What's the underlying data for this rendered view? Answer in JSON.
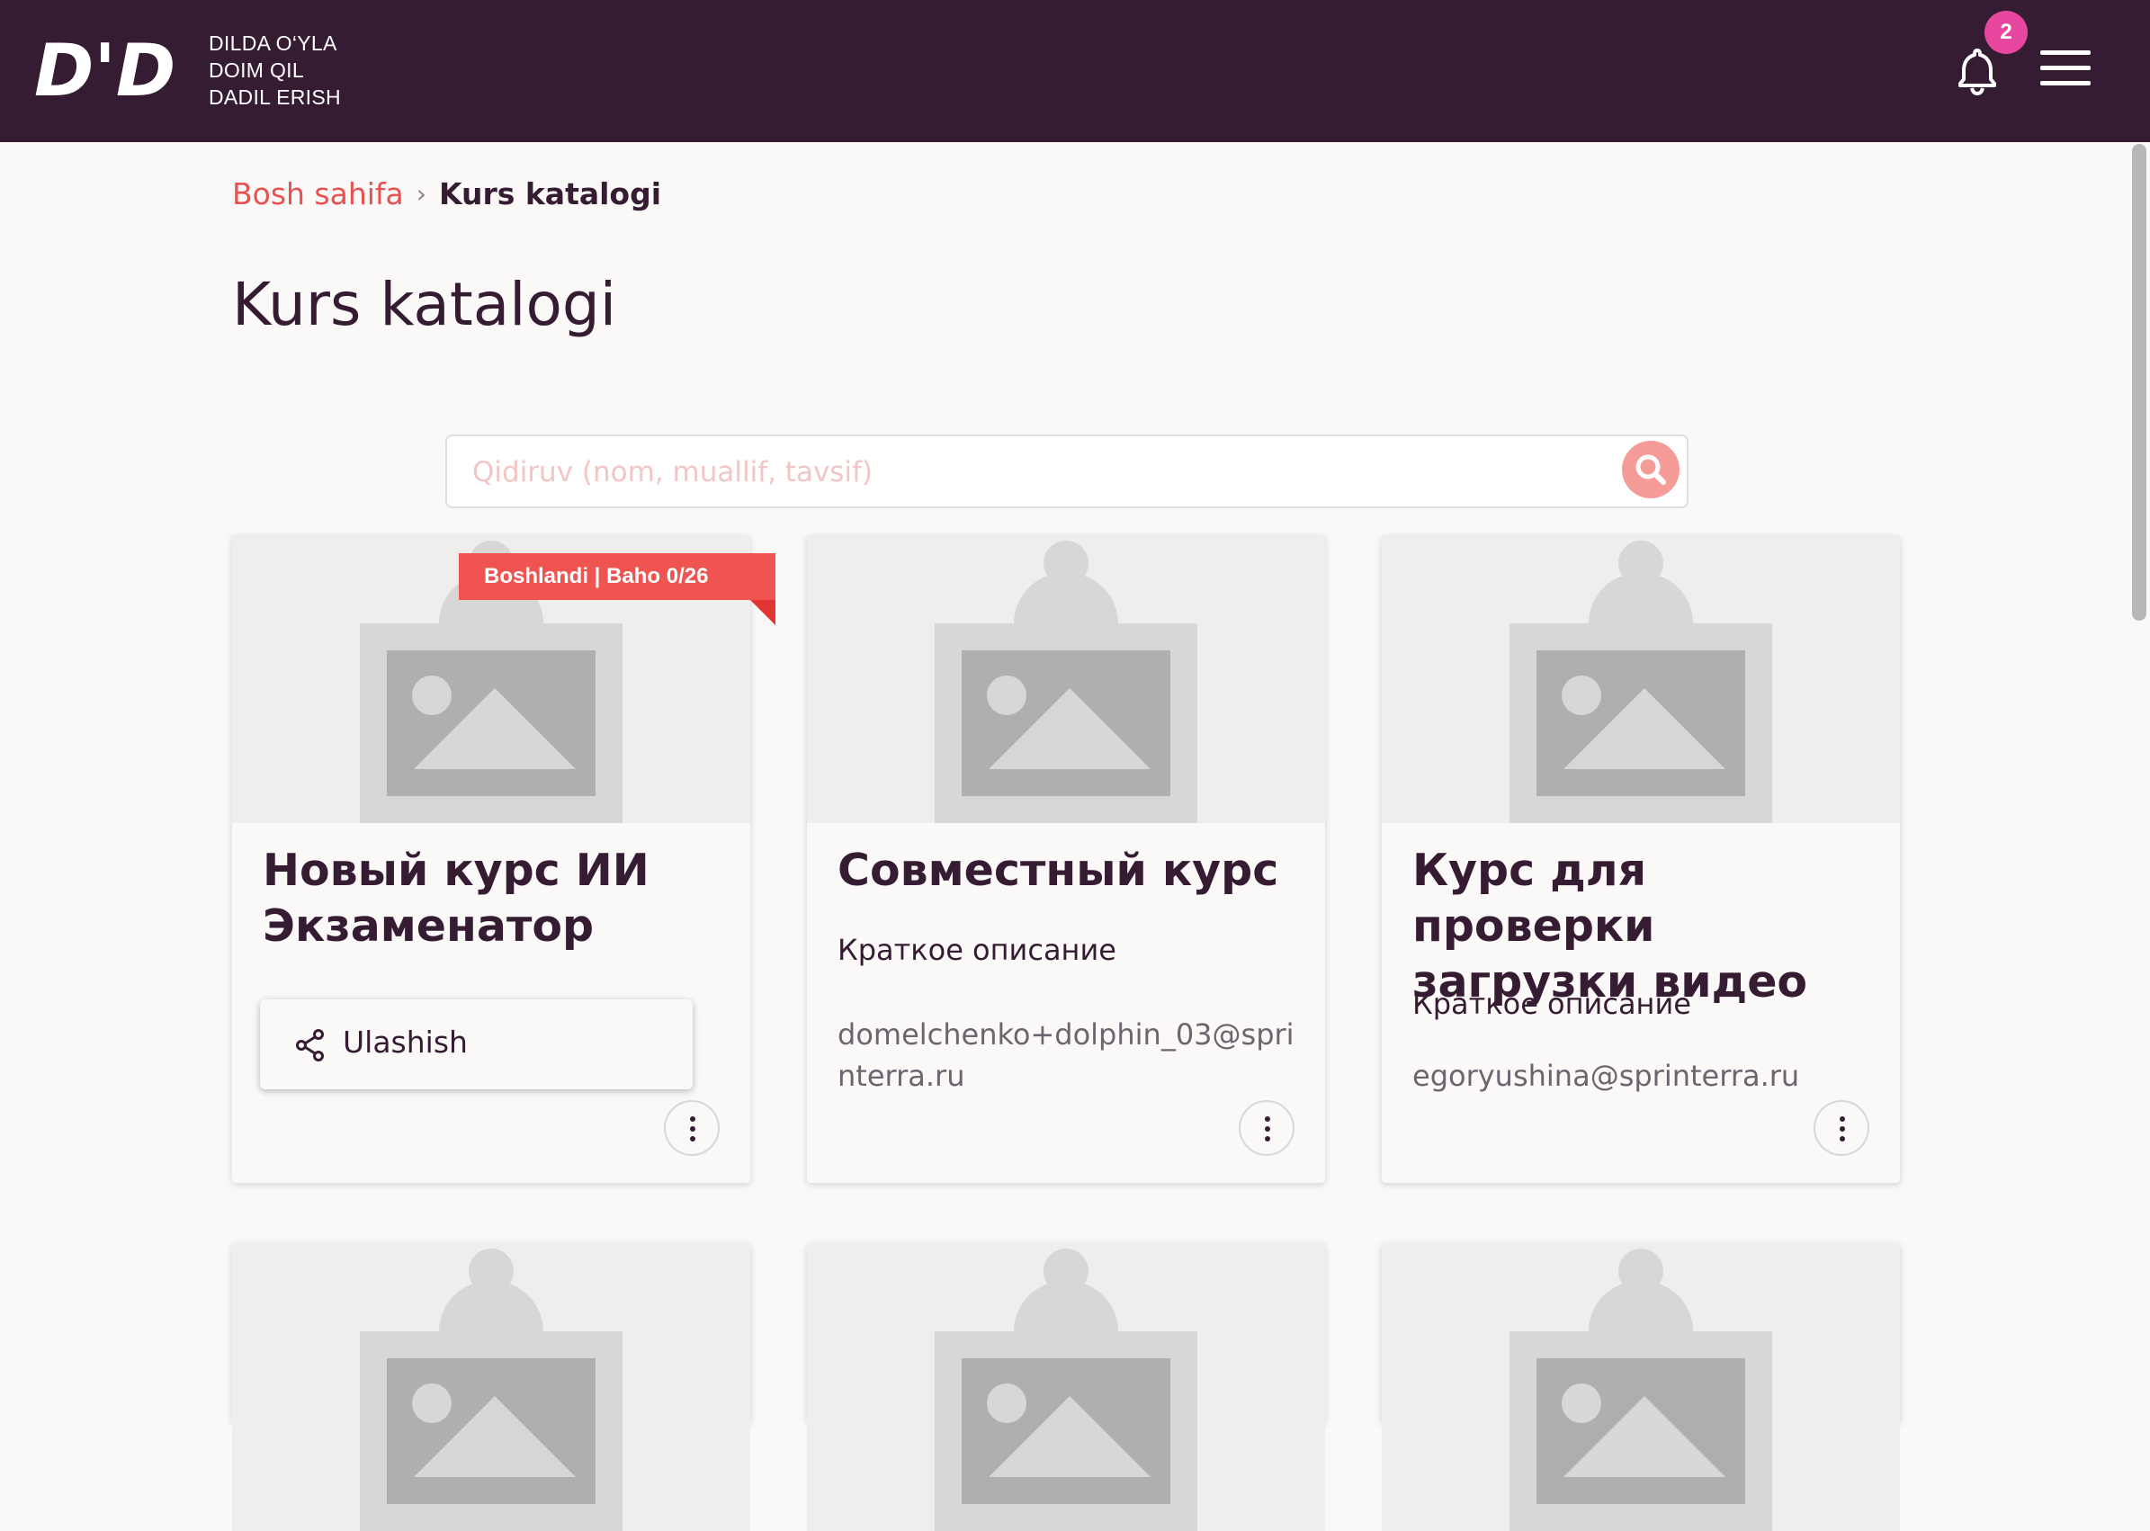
{
  "header": {
    "logo_text": "D'D",
    "tagline": [
      "DILDA O‘YLA",
      "DOIM QIL",
      "DADIL ERISH"
    ],
    "notification_count": "2"
  },
  "breadcrumb": {
    "home": "Bosh sahifa",
    "separator": "›",
    "current": "Kurs katalogi"
  },
  "page_title": "Kurs katalogi",
  "search": {
    "placeholder": "Qidiruv (nom, muallif, tavsif)",
    "value": ""
  },
  "courses": [
    {
      "status_badge": "Boshlandi | Baho 0/26",
      "title": "Новый курс ИИ Экзаменатор",
      "description": "",
      "author": ""
    },
    {
      "title": "Совместный курс",
      "description": "Краткое описание",
      "author": "domelchenko+dolphin_03@sprinterra.ru"
    },
    {
      "title": "Курс для проверки загрузки видео",
      "description": "Краткое описание",
      "author": "egoryushina@sprinterra.ru"
    }
  ],
  "context_menu": {
    "share_label": "Ulashish"
  },
  "colors": {
    "header_bg": "#361c33",
    "accent": "#e8514f",
    "badge": "#e8479f",
    "ribbon": "#f05451"
  }
}
